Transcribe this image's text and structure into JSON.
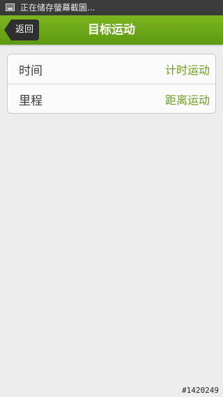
{
  "status_bar": {
    "icon": "screenshot-icon",
    "text": "正在储存螢幕截圖..."
  },
  "header": {
    "back_label": "返回",
    "title": "目标运动"
  },
  "rows": [
    {
      "label": "时间",
      "value": "计时运动"
    },
    {
      "label": "里程",
      "value": "距离运动"
    }
  ],
  "watermark": "#1420249",
  "colors": {
    "accent": "#6aa017",
    "header": "#6ea716",
    "status_bar": "#3b3b3b"
  }
}
